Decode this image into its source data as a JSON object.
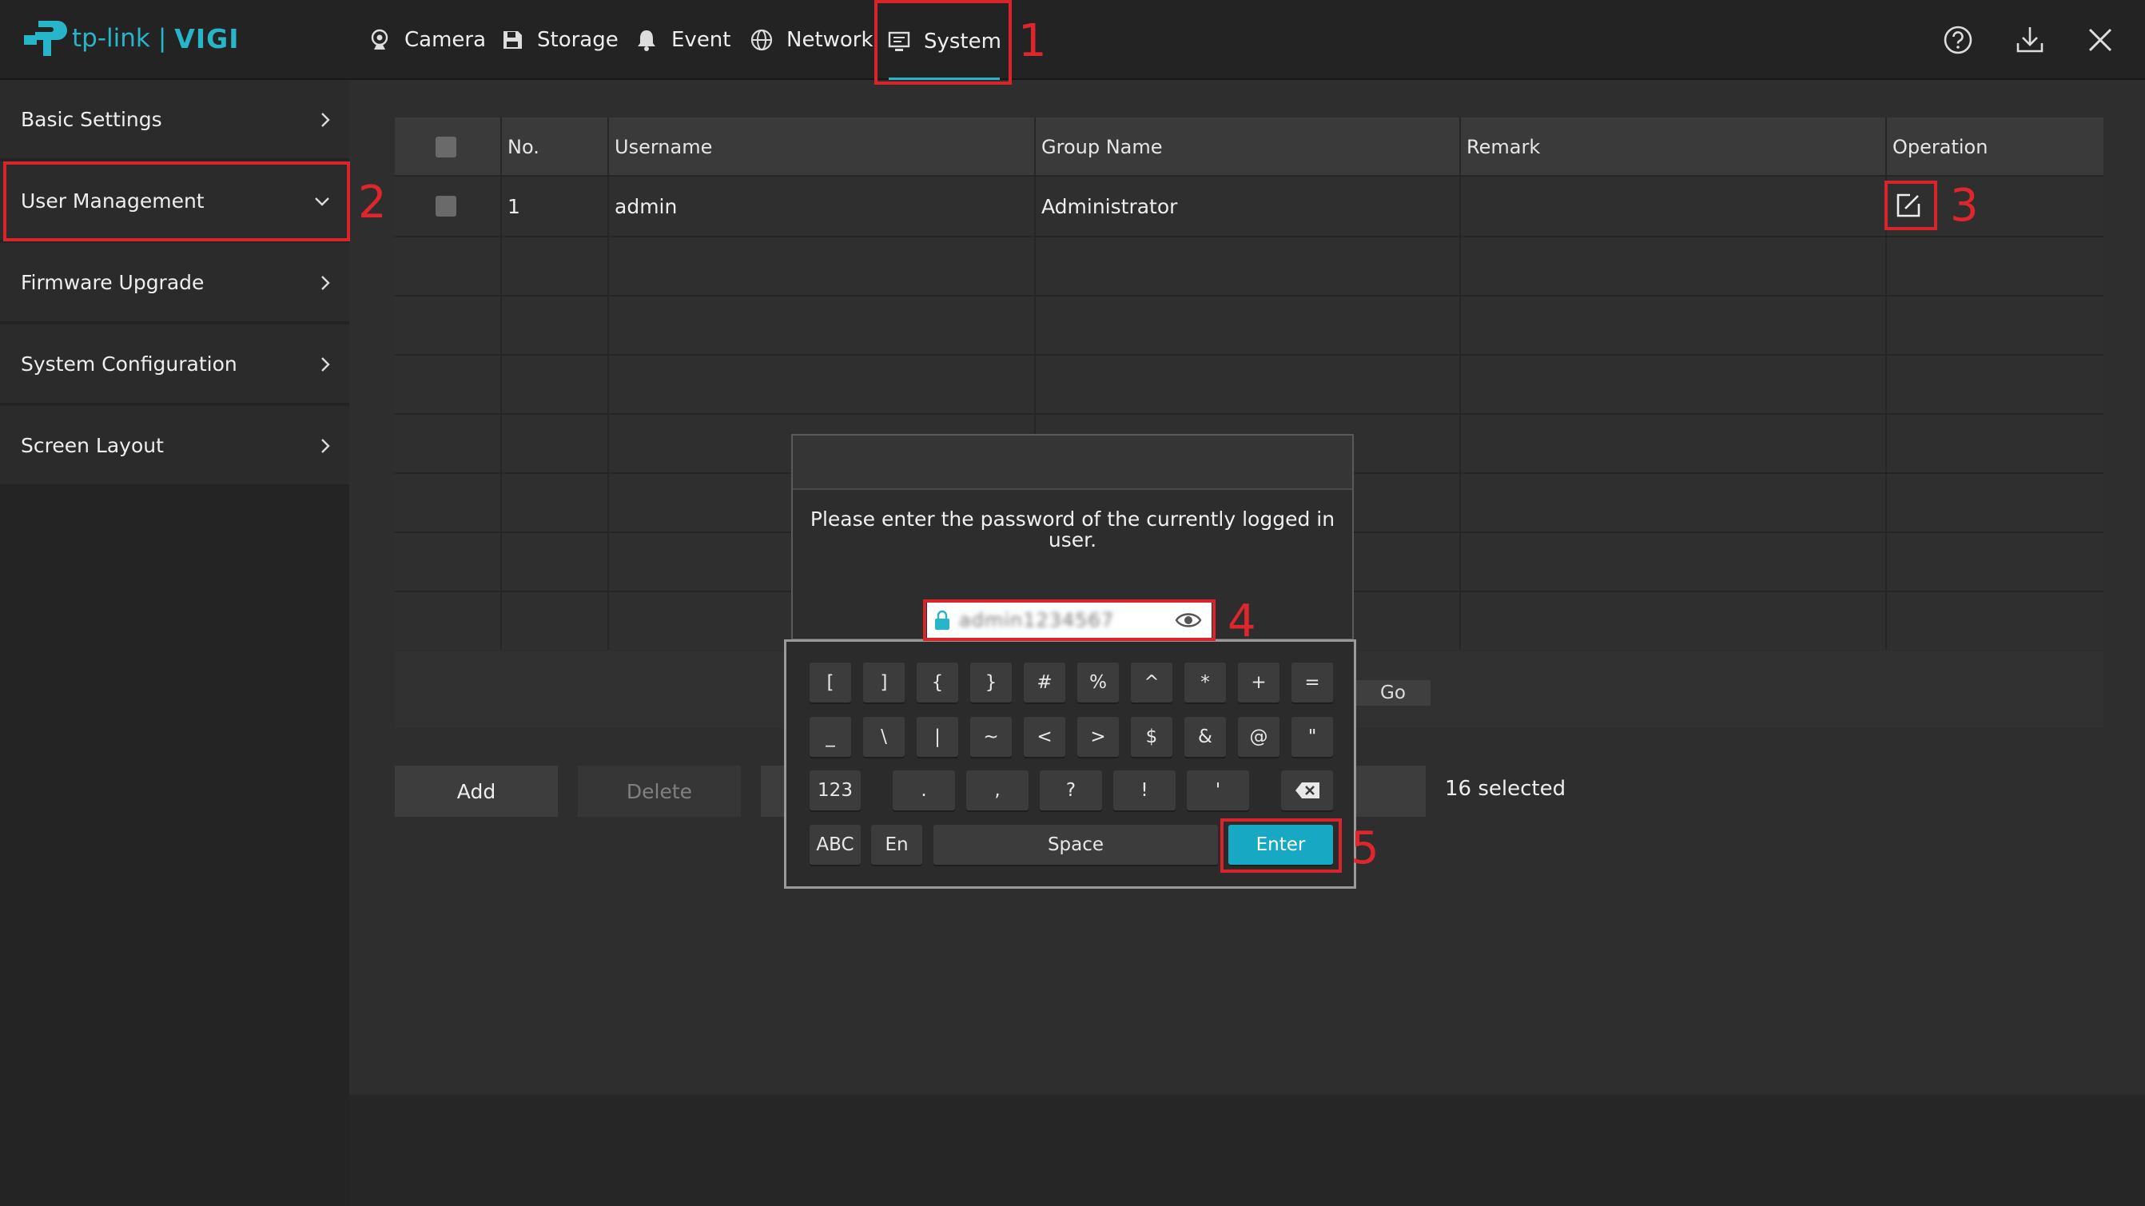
{
  "app": {
    "logo_text": "tp-link",
    "logo_sep": "|",
    "logo_product": "VIGI"
  },
  "nav": {
    "camera": "Camera",
    "storage": "Storage",
    "event": "Event",
    "network": "Network",
    "system": "System"
  },
  "toolbar_icons": [
    "help-icon",
    "download-icon",
    "close-icon"
  ],
  "sidebar": {
    "items": [
      {
        "label": "Basic Settings"
      },
      {
        "label": "User Management"
      },
      {
        "label": "Firmware Upgrade"
      },
      {
        "label": "System Configuration"
      },
      {
        "label": "Screen Layout"
      }
    ]
  },
  "table": {
    "headers": {
      "no": "No.",
      "username": "Username",
      "group": "Group Name",
      "remark": "Remark",
      "operation": "Operation"
    },
    "rows": [
      {
        "no": "1",
        "username": "admin",
        "group": "Administrator",
        "remark": ""
      }
    ]
  },
  "pager": {
    "go": "Go"
  },
  "actions": {
    "add": "Add",
    "delete": "Delete",
    "selected": "16 selected"
  },
  "dialog": {
    "message": "Please enter the password of the currently logged in user.",
    "password_value": "admin1234567"
  },
  "keyboard": {
    "row1": [
      "[",
      "]",
      "{",
      "}",
      "#",
      "%",
      "^",
      "*",
      "+",
      "="
    ],
    "row2": [
      "_",
      "\\",
      "|",
      "~",
      "<",
      ">",
      "$",
      "&",
      "@",
      "\""
    ],
    "row3": [
      "123",
      ".",
      ",",
      "?",
      "!",
      "'"
    ],
    "row4": {
      "abc": "ABC",
      "lang": "En",
      "space": "Space",
      "enter": "Enter"
    }
  },
  "annotations": [
    "1",
    "2",
    "3",
    "4",
    "5"
  ],
  "colors": {
    "accent": "#27b5c9",
    "highlight": "#d8242a",
    "enter_key": "#17a8c4"
  }
}
